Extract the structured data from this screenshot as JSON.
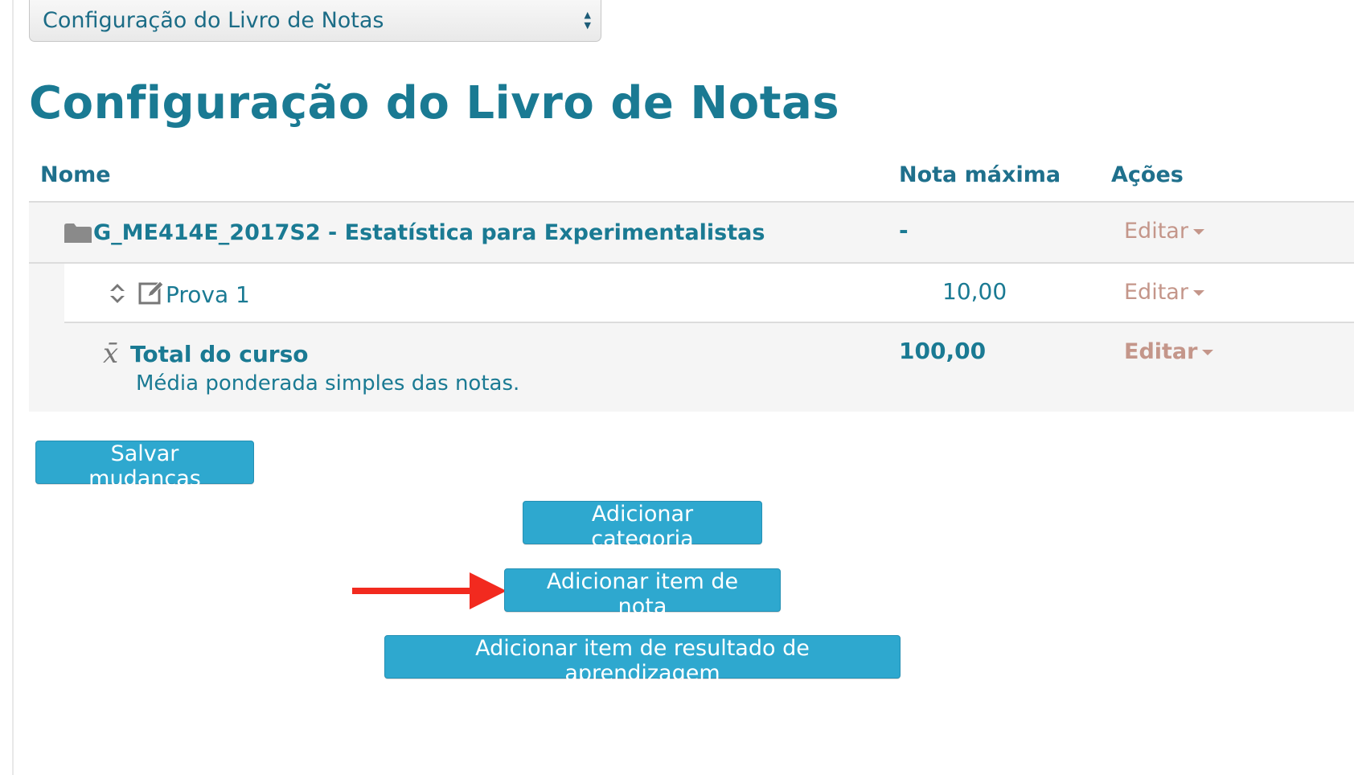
{
  "select": {
    "value": "Configuração do Livro de Notas",
    "arrows": "▲▼"
  },
  "page_title": "Configuração do Livro de Notas",
  "columns": {
    "name": "Nome",
    "max": "Nota máxima",
    "actions": "Ações"
  },
  "rows": [
    {
      "type": "category",
      "name": "G_ME414E_2017S2 - Estatística para Experimentalistas",
      "max": "-",
      "action": "Editar",
      "icon": "folder-icon"
    },
    {
      "type": "grade-item",
      "name": "Prova 1",
      "max": "10,00",
      "action": "Editar",
      "icons": [
        "move-icon",
        "edit-icon"
      ]
    },
    {
      "type": "course-total",
      "name": "Total do curso",
      "description": "Média ponderada simples das notas.",
      "max": "100,00",
      "action": "Editar",
      "icon": "x-bar-icon"
    }
  ],
  "buttons": {
    "save": "Salvar mudanças",
    "add_category": "Adicionar categoria",
    "add_grade_item": "Adicionar item de nota",
    "add_outcome_item": "Adicionar item de resultado de aprendizagem"
  },
  "colors": {
    "primary": "#1a7a93",
    "button": "#2ea8cf",
    "action_link": "#c4968a",
    "row_bg": "#f5f5f5",
    "arrow": "#f22a1f"
  }
}
